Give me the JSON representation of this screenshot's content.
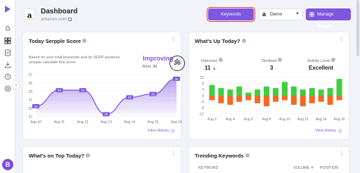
{
  "header": {
    "title": "Dashboard",
    "subtitle": "amazon.com",
    "brand_glyph": "a",
    "keywords_button": "Keywords",
    "marketplace": {
      "glyph": "a",
      "value": "Demo"
    },
    "manage_widgets_button": "Manage Widgets"
  },
  "sidebar": {
    "items": [
      "rocket-icon",
      "dashboard-icon",
      "reports-icon",
      "downloads-icon",
      "history-icon",
      "settings-icon"
    ],
    "avatar_initial": "B"
  },
  "serp_card": {
    "title": "Today Serpple Score",
    "description": "Based on your total keywords and its SERP positions serpple calculate this score.",
    "status": "Improving",
    "status_arrow": "▲",
    "best_label": "Best: 38",
    "score": "36",
    "view_history": "View History",
    "chart_data": {
      "type": "area",
      "x": [
        "Aug 10",
        "Aug 11",
        "Aug 12",
        "Aug 13",
        "Aug 14",
        "Aug 15",
        "Aug 16"
      ],
      "y_ticks": [
        27,
        29,
        31,
        33,
        35,
        37
      ],
      "ylim": [
        27,
        37
      ],
      "values": [
        29.5,
        33.3,
        33.3,
        27.6,
        31.6,
        32.4,
        36.0
      ],
      "labels": [
        "30",
        "34",
        "34",
        "28",
        "32",
        "33",
        "36"
      ]
    }
  },
  "whats_up_card": {
    "title": "What's Up Today?",
    "improved_label": "Improved",
    "improved_value": "11",
    "improved_arrow": "▲",
    "declined_label": "Declined",
    "declined_value": "3",
    "activity_label": "Activity Level",
    "activity_value": "Excellent",
    "view_history": "View History",
    "chart_data": {
      "type": "bar",
      "categories": [
        "Aug 2",
        "Aug 3",
        "Aug 4",
        "Aug 5",
        "Aug 6",
        "Aug 7",
        "Aug 8",
        "Aug 9",
        "Aug 10",
        "Aug 11",
        "Aug 12",
        "Aug 13",
        "Aug 14",
        "Aug 15",
        "Aug 16"
      ],
      "x_tick_labels": [
        "Aug 2",
        "Aug 4",
        "Aug 6",
        "Aug 8",
        "Aug 10",
        "Aug 12",
        "Aug 14",
        "Aug 16"
      ],
      "y_ticks": [
        12,
        8,
        4,
        0,
        -4,
        -8,
        -12
      ],
      "ylim": [
        -12,
        12
      ],
      "series": [
        {
          "color": "#3fce3f",
          "values": [
            7,
            5,
            4,
            6,
            2,
            4,
            6,
            5,
            9,
            6,
            4,
            5,
            4,
            5,
            11
          ]
        },
        {
          "color": "#f26a22",
          "values": [
            -3,
            -5,
            -6,
            -4,
            -3,
            -5,
            -7,
            -4,
            -3,
            -6,
            -7,
            -5,
            -4,
            -6,
            -3
          ]
        }
      ]
    }
  },
  "top_card": {
    "title": "What's on Top Today?"
  },
  "trending_card": {
    "title": "Trending Keywords",
    "columns": [
      "KEYWORD",
      "VOLUME",
      "POSITION"
    ],
    "sort_arrow": "▼"
  },
  "colors": {
    "accent": "#7e57e0",
    "positive": "#3fce3f",
    "negative": "#f26a22"
  }
}
